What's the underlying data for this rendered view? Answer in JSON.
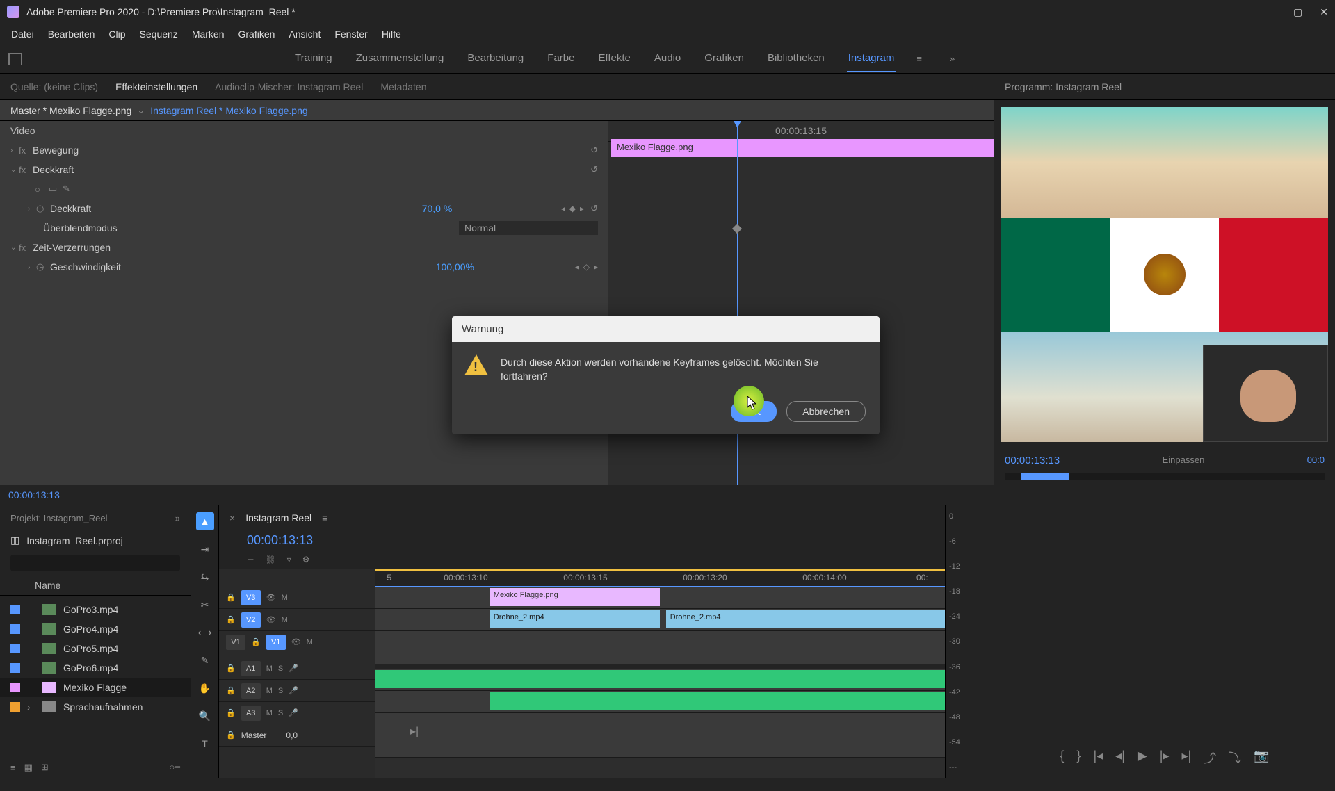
{
  "titlebar": {
    "title": "Adobe Premiere Pro 2020 - D:\\Premiere Pro\\Instagram_Reel *"
  },
  "menubar": [
    "Datei",
    "Bearbeiten",
    "Clip",
    "Sequenz",
    "Marken",
    "Grafiken",
    "Ansicht",
    "Fenster",
    "Hilfe"
  ],
  "workspaces": {
    "items": [
      "Training",
      "Zusammenstellung",
      "Bearbeitung",
      "Farbe",
      "Effekte",
      "Audio",
      "Grafiken",
      "Bibliotheken",
      "Instagram"
    ],
    "active": "Instagram"
  },
  "ec_tabs": {
    "items": [
      "Quelle: (keine Clips)",
      "Effekteinstellungen",
      "Audioclip-Mischer: Instagram Reel",
      "Metadaten"
    ],
    "active": "Effekteinstellungen"
  },
  "ec_header": {
    "master": "Master * Mexiko Flagge.png",
    "sequence": "Instagram Reel * Mexiko Flagge.png"
  },
  "ec_props": {
    "section": "Video",
    "motion": "Bewegung",
    "opacity_group": "Deckkraft",
    "opacity": {
      "label": "Deckkraft",
      "value": "70,0 %"
    },
    "blendmode": {
      "label": "Überblendmodus",
      "value": "Normal"
    },
    "timeremap": "Zeit-Verzerrungen",
    "speed": {
      "label": "Geschwindigkeit",
      "value": "100,00%"
    }
  },
  "ec_kf": {
    "timecode": "00:00:13:15",
    "clip": "Mexiko Flagge.png"
  },
  "program": {
    "title": "Programm: Instagram Reel",
    "timecode": "00:00:13:13",
    "fit_label": "Einpassen",
    "endtc": "00:0"
  },
  "project": {
    "tab": "Projekt: Instagram_Reel",
    "file": "Instagram_Reel.prproj",
    "col": "Name",
    "items": [
      {
        "name": "GoPro3.mp4",
        "type": "video"
      },
      {
        "name": "GoPro4.mp4",
        "type": "video"
      },
      {
        "name": "GoPro5.mp4",
        "type": "video"
      },
      {
        "name": "GoPro6.mp4",
        "type": "video"
      },
      {
        "name": "Mexiko Flagge",
        "type": "image"
      },
      {
        "name": "Sprachaufnahmen",
        "type": "bin"
      }
    ]
  },
  "timeline": {
    "name": "Instagram Reel",
    "timecode": "00:00:13:13",
    "ruler": [
      "5",
      "00:00:13:10",
      "00:00:13:15",
      "00:00:13:20",
      "00:00:14:00",
      "00:"
    ],
    "tracks": {
      "v3": "V3",
      "v2": "V2",
      "v1": "V1",
      "v1src": "V1",
      "a1": "A1",
      "a2": "A2",
      "a3": "A3",
      "master": "Master",
      "masterval": "0,0"
    },
    "clips": {
      "v3_img": "Mexiko Flagge.png",
      "v2_left": "Drohne_2.mp4",
      "v2_right": "Drohne_2.mp4"
    }
  },
  "audio_scale": [
    "0",
    "-6",
    "-12",
    "-18",
    "-24",
    "-30",
    "-36",
    "-42",
    "-48",
    "-54",
    "---"
  ],
  "dialog": {
    "title": "Warnung",
    "message": "Durch diese Aktion werden vorhandene Keyframes gelöscht. Möchten Sie fortfahren?",
    "ok": "OK",
    "cancel": "Abbrechen"
  },
  "bottom_tc": "00:00:13:13"
}
